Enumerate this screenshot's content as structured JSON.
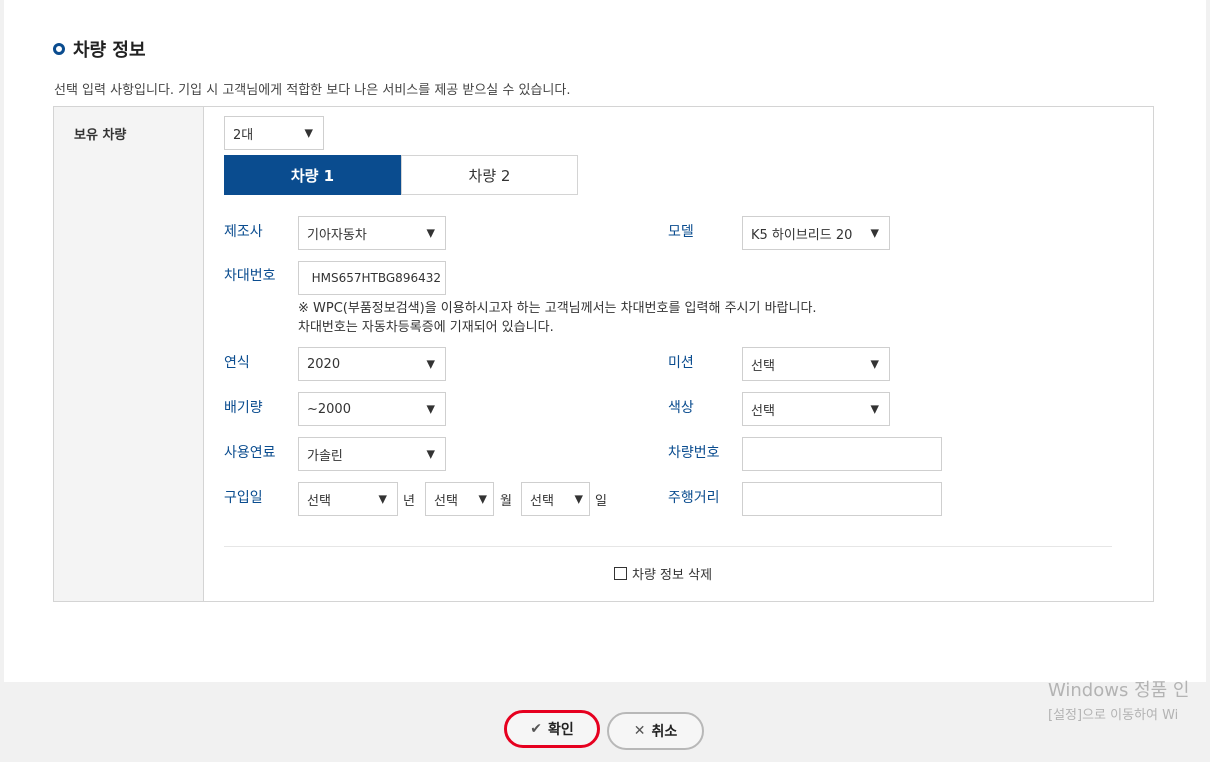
{
  "section": {
    "title": "차량 정보",
    "description": "선택 입력 사항입니다. 기입 시 고객님에게 적합한 보다 나은 서비스를 제공 받으실 수 있습니다."
  },
  "owned": {
    "label": "보유 차량",
    "count_value": "2대",
    "tabs": [
      {
        "label": "차량 1",
        "active": true
      },
      {
        "label": "차량 2",
        "active": false
      }
    ]
  },
  "vehicle": {
    "manufacturer_label": "제조사",
    "manufacturer_value": "기아자동차",
    "model_label": "모델",
    "model_value": "K5 하이브리드 20",
    "vin_label": "차대번호",
    "vin_value": "HMS657HTBG896432",
    "notice_line1": "※ WPC(부품정보검색)을 이용하시고자 하는 고객님께서는 차대번호를 입력해 주시기 바랍니다.",
    "notice_line2": "차대번호는 자동차등록증에 기재되어 있습니다.",
    "year_label": "연식",
    "year_value": "2020",
    "transmission_label": "미션",
    "transmission_value": "선택",
    "displacement_label": "배기량",
    "displacement_value": "~2000",
    "color_label": "색상",
    "color_value": "선택",
    "fuel_label": "사용연료",
    "fuel_value": "가솔린",
    "plate_label": "차량번호",
    "plate_value": "",
    "purchase_label": "구입일",
    "purchase_year_value": "선택",
    "purchase_year_unit": "년",
    "purchase_month_value": "선택",
    "purchase_month_unit": "월",
    "purchase_day_value": "선택",
    "purchase_day_unit": "일",
    "mileage_label": "주행거리",
    "mileage_value": "",
    "delete_label": "차량 정보 삭제"
  },
  "buttons": {
    "confirm_label": "확인",
    "cancel_label": "취소"
  },
  "watermark": {
    "line1": "Windows 정품 인",
    "line2": "[설정]으로 이동하여 Wi"
  },
  "colors": {
    "accent": "#0a4c8f",
    "highlight": "#e6001f"
  }
}
